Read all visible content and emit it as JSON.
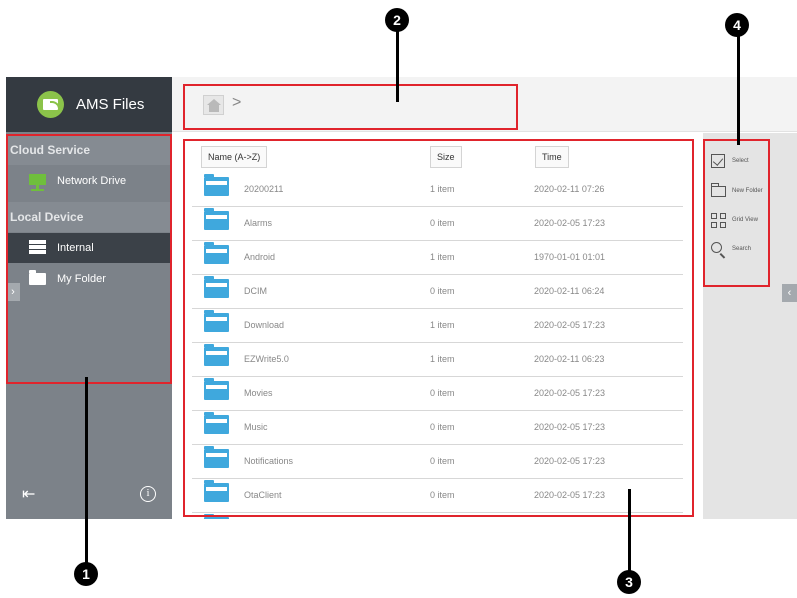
{
  "app": {
    "title": "AMS Files"
  },
  "sidebar": {
    "sections": [
      {
        "header": "Cloud Service",
        "items": [
          {
            "label": "Network Drive",
            "icon": "network-drive-icon"
          }
        ]
      },
      {
        "header": "Local Device",
        "items": [
          {
            "label": "Internal",
            "icon": "storage-icon",
            "active": true
          },
          {
            "label": "My Folder",
            "icon": "folder-icon"
          }
        ]
      }
    ],
    "expand_glyph": "›",
    "logout_icon": "logout-icon",
    "info_glyph": "i"
  },
  "breadcrumb": {
    "home_icon": "home-icon",
    "separator": ">"
  },
  "table": {
    "columns": {
      "name": "Name (A->Z)",
      "size": "Size",
      "time": "Time"
    },
    "rows": [
      {
        "name": "20200211",
        "size": "1 item",
        "time": "2020-02-11  07:26"
      },
      {
        "name": "Alarms",
        "size": "0 item",
        "time": "2020-02-05  17:23"
      },
      {
        "name": "Android",
        "size": "1 item",
        "time": "1970-01-01  01:01"
      },
      {
        "name": "DCIM",
        "size": "0 item",
        "time": "2020-02-11  06:24"
      },
      {
        "name": "Download",
        "size": "1 item",
        "time": "2020-02-05  17:23"
      },
      {
        "name": "EZWrite5.0",
        "size": "1 item",
        "time": "2020-02-11  06:23"
      },
      {
        "name": "Movies",
        "size": "0 item",
        "time": "2020-02-05  17:23"
      },
      {
        "name": "Music",
        "size": "0 item",
        "time": "2020-02-05  17:23"
      },
      {
        "name": "Notifications",
        "size": "0 item",
        "time": "2020-02-05  17:23"
      },
      {
        "name": "OtaClient",
        "size": "0 item",
        "time": "2020-02-05  17:23"
      }
    ]
  },
  "actions": [
    {
      "label": "Select",
      "icon": "checkbox-icon"
    },
    {
      "label": "New Folder",
      "icon": "new-folder-icon"
    },
    {
      "label": "Grid View",
      "icon": "grid-view-icon"
    },
    {
      "label": "Search",
      "icon": "search-icon"
    }
  ],
  "panel_collapse_glyph": "‹",
  "callouts": [
    "1",
    "2",
    "3",
    "4"
  ],
  "colors": {
    "callout": "#e0242c",
    "folder": "#3fa8dd",
    "brand": "#8bc34a"
  }
}
